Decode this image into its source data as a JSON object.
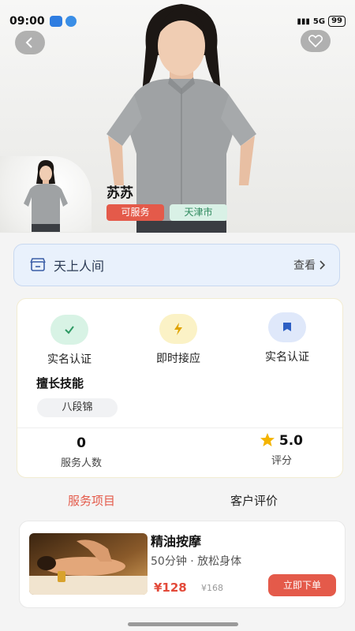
{
  "status_bar": {
    "time": "09:00",
    "battery": "99",
    "network": "5G"
  },
  "colors": {
    "accent_red": "#e45a4a",
    "price_red": "#e34a3a",
    "tag_green_bg": "#d9f1e6",
    "shop_bg": "#e9f1fc"
  },
  "header": {
    "back_icon": "chevron-left-icon",
    "favorite_icon": "heart-icon"
  },
  "profile": {
    "name": "苏苏",
    "tags": [
      {
        "label": "可服务"
      },
      {
        "label": "天津市"
      }
    ]
  },
  "shop": {
    "icon": "store-icon",
    "name": "天上人间",
    "view_label": "查看"
  },
  "features": [
    {
      "label": "实名认证",
      "icon": "check-icon",
      "color": "#d8f3e5"
    },
    {
      "label": "即时接应",
      "icon": "lightning-icon",
      "color": "#fbf2c6"
    },
    {
      "label": "实名认证",
      "icon": "flag-icon",
      "color": "#dfe8fa"
    }
  ],
  "skills": {
    "title": "擅长技能",
    "items": [
      "八段锦"
    ]
  },
  "stats": [
    {
      "value": "0",
      "label": "服务人数"
    },
    {
      "value": "5.0",
      "label": "评分",
      "icon": "star-icon"
    }
  ],
  "tabs": [
    {
      "label": "服务项目",
      "active": true
    },
    {
      "label": "客户评价",
      "active": false
    }
  ],
  "services": [
    {
      "title": "精油按摩",
      "description": "50分钟 · 放松身体",
      "price": "¥128",
      "original_price": "¥168",
      "order_label": "立即下单"
    }
  ]
}
